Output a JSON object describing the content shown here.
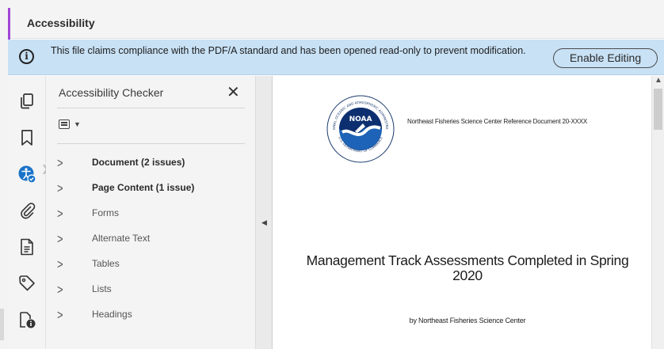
{
  "header": {
    "title": "Accessibility"
  },
  "notice": {
    "message": "This file claims compliance with the PDF/A standard and has been opened read-only to prevent modification.",
    "button_label": "Enable Editing",
    "icon": "info-icon"
  },
  "iconbar": {
    "items": [
      {
        "name": "pages-icon"
      },
      {
        "name": "bookmark-icon"
      },
      {
        "name": "accessibility-checker-icon"
      },
      {
        "name": "attachment-icon"
      },
      {
        "name": "document-properties-icon"
      },
      {
        "name": "tags-icon"
      },
      {
        "name": "reading-order-icon"
      }
    ]
  },
  "panel": {
    "title": "Accessibility Checker",
    "close_glyph": "✕",
    "items": [
      {
        "label": "Document (2 issues)",
        "bold": true
      },
      {
        "label": "Page Content (1 issue)",
        "bold": true
      },
      {
        "label": "Forms",
        "bold": false
      },
      {
        "label": "Alternate Text",
        "bold": false
      },
      {
        "label": "Tables",
        "bold": false
      },
      {
        "label": "Lists",
        "bold": false
      },
      {
        "label": "Headings",
        "bold": false
      }
    ]
  },
  "document": {
    "header_text": "Northeast Fisheries Science Center Reference Document 20-XXXX",
    "title": "Management Track Assessments Completed in Spring 2020",
    "by_line": "by Northeast Fisheries Science Center",
    "logo": {
      "center_text": "NOAA",
      "ring_top": "NATIONAL OCEANIC AND ATMOSPHERIC ADMINISTRATION",
      "ring_bottom": "U.S. DEPARTMENT OF COMMERCE"
    }
  },
  "colors": {
    "notice_bg": "#c8e1f5",
    "accent": "#a046d8",
    "a11y_blue": "#1a73c8"
  }
}
